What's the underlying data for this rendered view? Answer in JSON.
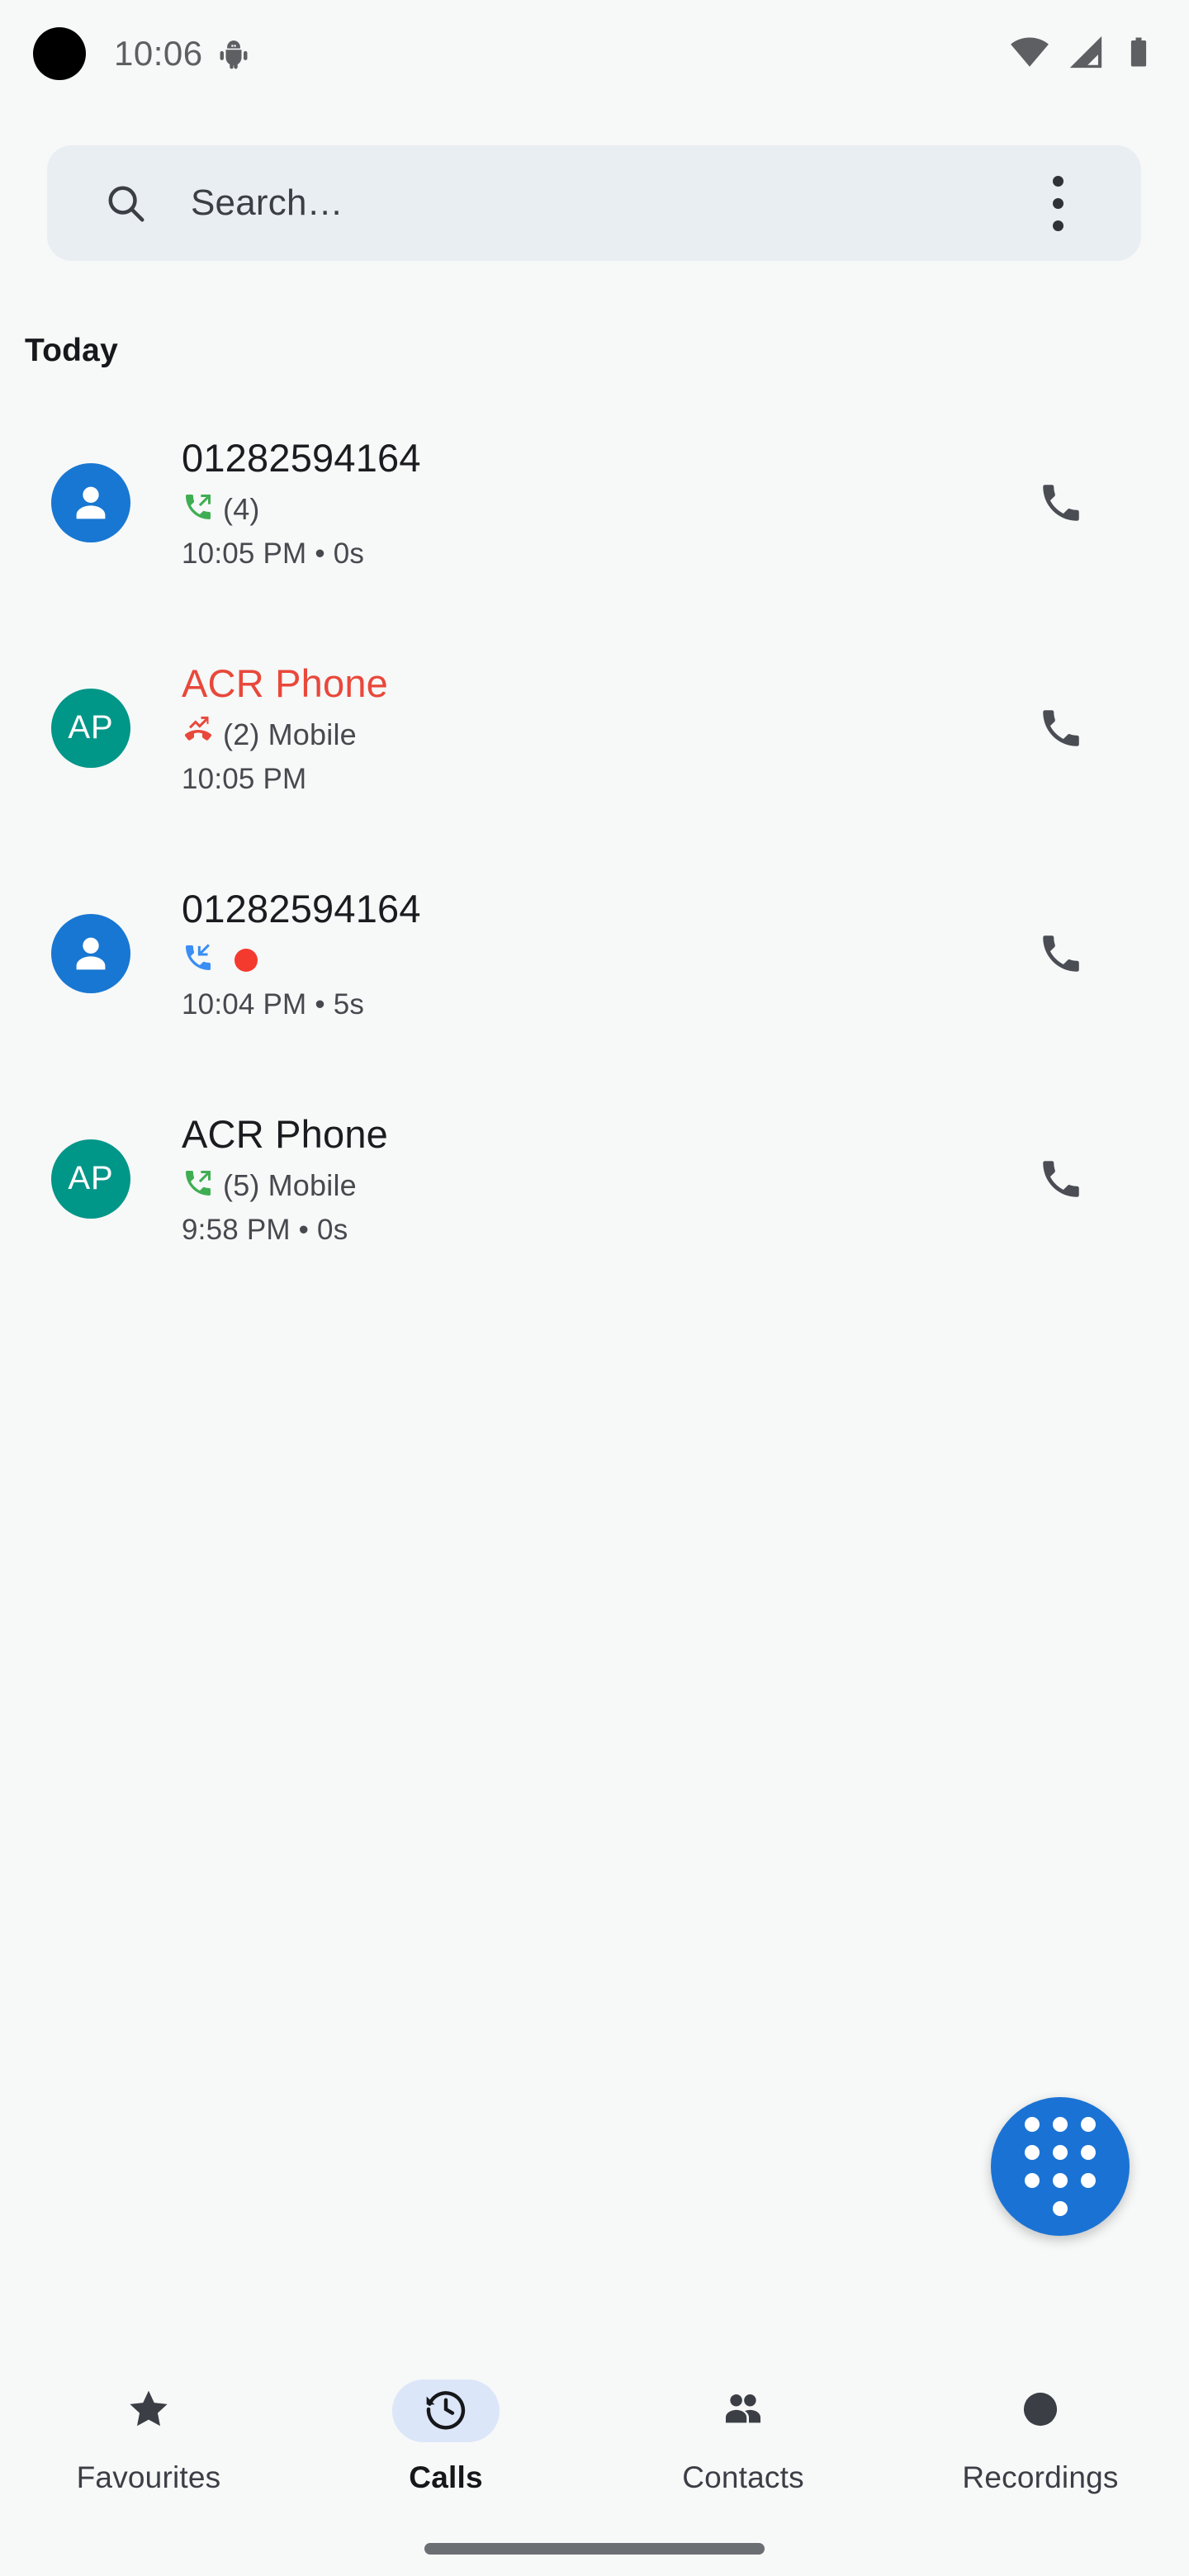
{
  "status_bar": {
    "time": "10:06",
    "camera_cutout": "camera-cutout",
    "debug_icon": "android-debug-icon",
    "wifi_icon": "wifi-full-icon",
    "cellular_icon": "cellular-signal-icon",
    "battery_icon": "battery-full-icon"
  },
  "search": {
    "placeholder": "Search…",
    "value": "",
    "icon": "search-icon",
    "overflow_icon": "more-vert-icon"
  },
  "sections": [
    {
      "label": "Today"
    }
  ],
  "calls": [
    {
      "title": "01282594164",
      "missed": false,
      "avatar": {
        "type": "person-icon",
        "initials": "",
        "color": "#1877d2"
      },
      "direction_icon": "call-made-icon",
      "direction_color": "#3fae52",
      "count": "(4)",
      "line_label": "",
      "recorded": false,
      "time": "10:05 PM • 0s",
      "action_icon": "phone-icon"
    },
    {
      "title": "ACR Phone",
      "missed": true,
      "avatar": {
        "type": "initials",
        "initials": "AP",
        "color": "#009688"
      },
      "direction_icon": "call-missed-icon",
      "direction_color": "#e8483b",
      "count": "(2)",
      "line_label": "Mobile",
      "recorded": false,
      "time": "10:05 PM",
      "action_icon": "phone-icon"
    },
    {
      "title": "01282594164",
      "missed": false,
      "avatar": {
        "type": "person-icon",
        "initials": "",
        "color": "#1877d2"
      },
      "direction_icon": "call-received-icon",
      "direction_color": "#3b8ef3",
      "count": "",
      "line_label": "",
      "recorded": true,
      "time": "10:04 PM • 5s",
      "action_icon": "phone-icon"
    },
    {
      "title": "ACR Phone",
      "missed": false,
      "avatar": {
        "type": "initials",
        "initials": "AP",
        "color": "#009688"
      },
      "direction_icon": "call-made-icon",
      "direction_color": "#3fae52",
      "count": "(5)",
      "line_label": "Mobile",
      "recorded": false,
      "time": "9:58 PM • 0s",
      "action_icon": "phone-icon"
    }
  ],
  "fab": {
    "icon": "dialpad-icon",
    "color": "#1a73d4"
  },
  "bottom_nav": {
    "active_index": 1,
    "items": [
      {
        "label": "Favourites",
        "icon": "star-icon"
      },
      {
        "label": "Calls",
        "icon": "history-icon"
      },
      {
        "label": "Contacts",
        "icon": "people-icon"
      },
      {
        "label": "Recordings",
        "icon": "record-circle-icon"
      }
    ]
  },
  "colors": {
    "background": "#f7f8f8",
    "search_bg": "#e9eef3",
    "accent_blue": "#1a73d4",
    "avatar_blue": "#1877d2",
    "avatar_teal": "#009688",
    "missed_red": "#e8483b",
    "outgoing_green": "#3fae52",
    "incoming_blue": "#3b8ef3",
    "record_red": "#f4392e",
    "nav_active_pill": "#dce6f9"
  }
}
